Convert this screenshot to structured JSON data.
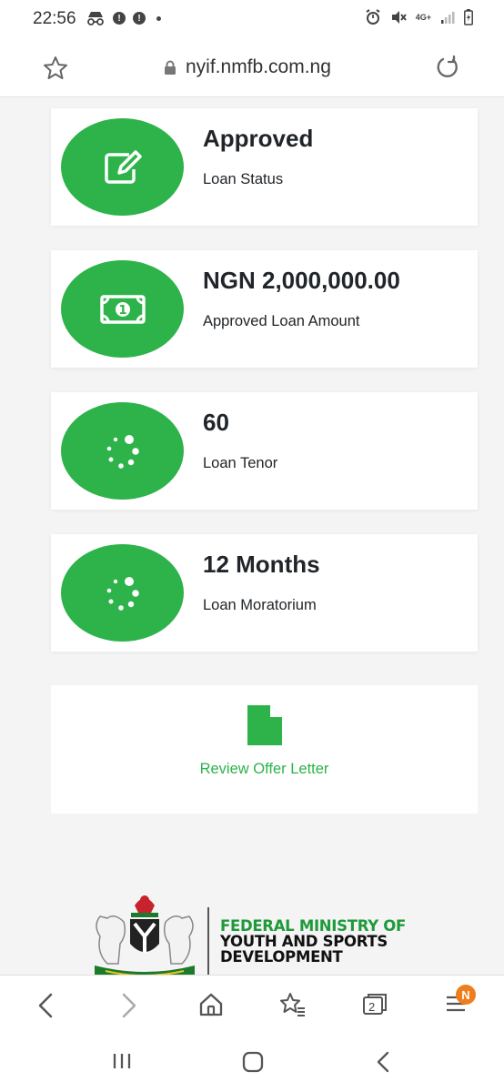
{
  "status_bar": {
    "time": "22:56",
    "network": "4G+"
  },
  "browser": {
    "url": "nyif.nmfb.com.ng",
    "tabs_count": "2",
    "menu_badge": "N"
  },
  "cards": [
    {
      "value": "Approved",
      "label": "Loan Status",
      "icon": "edit-icon"
    },
    {
      "value": "NGN 2,000,000.00",
      "label": "Approved Loan Amount",
      "icon": "money-icon"
    },
    {
      "value": "60",
      "label": "Loan Tenor",
      "icon": "spinner-icon"
    },
    {
      "value": "12 Months",
      "label": "Loan Moratorium",
      "icon": "spinner-icon"
    }
  ],
  "offer": {
    "link_text": "Review Offer Letter",
    "icon": "document-icon"
  },
  "footer": {
    "ministry_line1": "FEDERAL MINISTRY OF",
    "ministry_line2": "YOUTH AND SPORTS",
    "ministry_line3": "DEVELOPMENT"
  },
  "colors": {
    "accent": "#2db34a",
    "badge": "#f07d1d"
  }
}
